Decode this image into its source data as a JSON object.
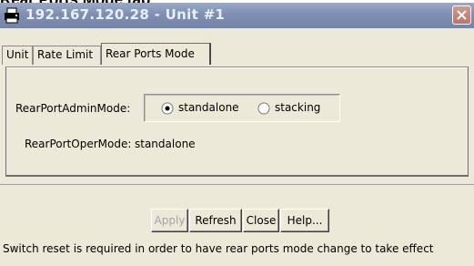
{
  "document": {
    "heading": "Rear Ports Mode tab"
  },
  "window": {
    "title": "192.167.120.28 - Unit #1",
    "icons": {
      "app": "printer-icon",
      "close": "close-icon"
    }
  },
  "tabs": [
    {
      "label": "Unit",
      "active": false
    },
    {
      "label": "Rate Limit",
      "active": false
    },
    {
      "label": "Rear Ports Mode",
      "active": true
    }
  ],
  "form": {
    "admin_mode_label": "RearPortAdminMode:",
    "admin_mode_options": [
      {
        "label": "standalone",
        "selected": true
      },
      {
        "label": "stacking",
        "selected": false
      }
    ],
    "oper_mode_label": "RearPortOperMode:",
    "oper_mode_value": "standalone"
  },
  "buttons": {
    "apply": "Apply",
    "refresh": "Refresh",
    "close": "Close",
    "help": "Help..."
  },
  "status_note": "Switch reset is required in order to have rear ports mode change to take effect",
  "colors": {
    "window_bg": "#ece9d8",
    "titlebar": "#7f8fb2",
    "close_button": "#c0887b",
    "disabled_text": "#a4a4a4"
  }
}
